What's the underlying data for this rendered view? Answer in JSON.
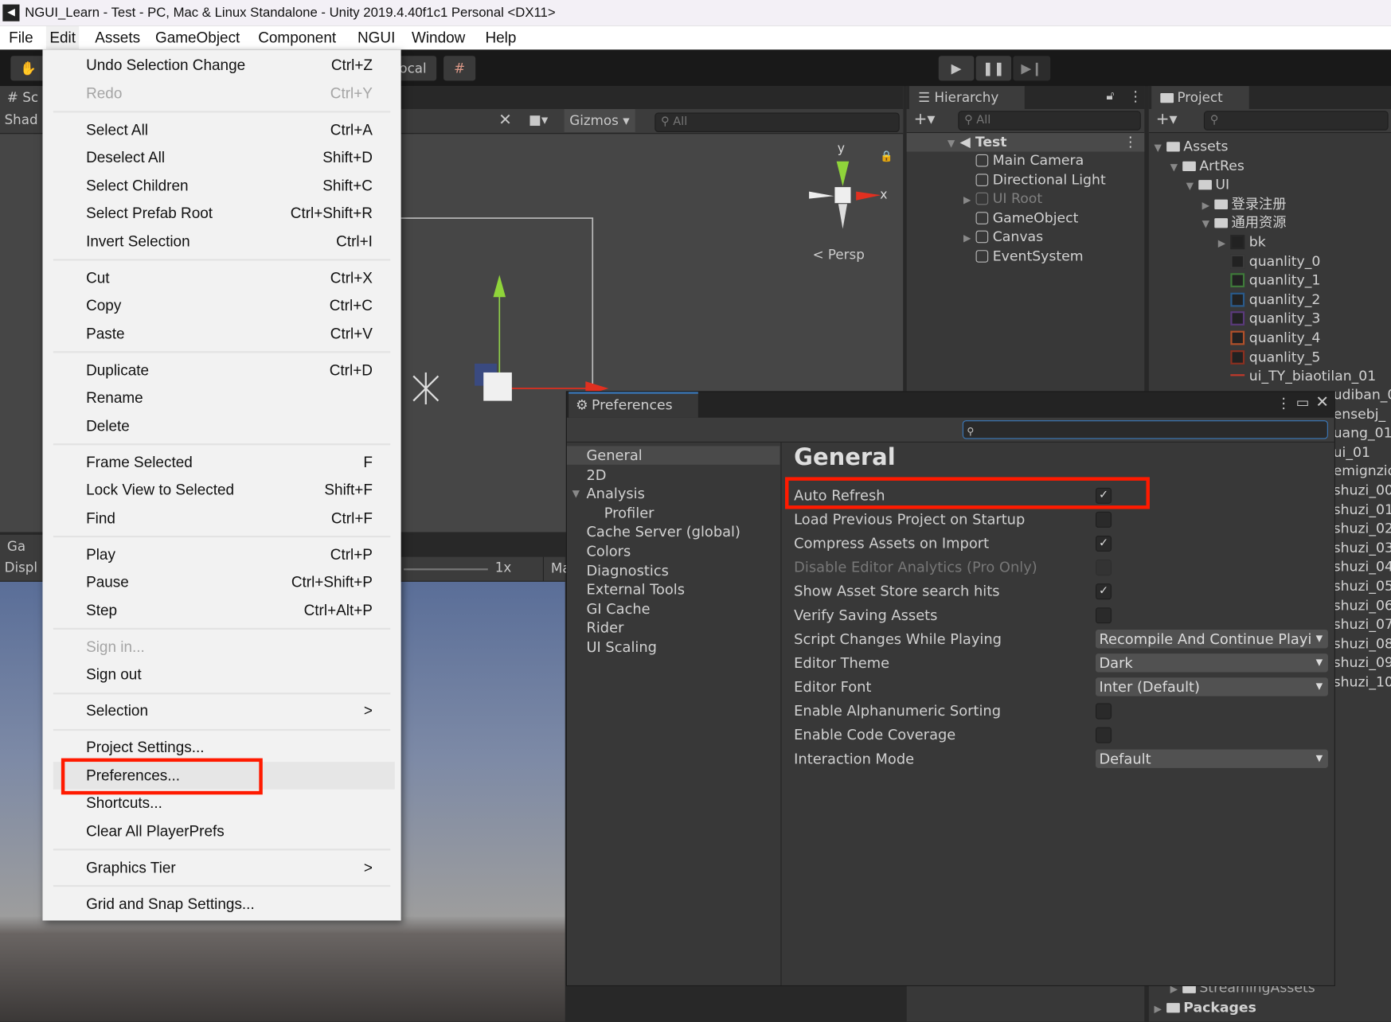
{
  "window": {
    "title": "NGUI_Learn - Test - PC, Mac & Linux Standalone - Unity 2019.4.40f1c1 Personal <DX11>",
    "logo": "unity-logo"
  },
  "menubar": [
    "File",
    "Edit",
    "Assets",
    "GameObject",
    "Component",
    "NGUI",
    "Window",
    "Help"
  ],
  "toolbar": {
    "pivot_label": "ocal",
    "play": "play-icon",
    "pause": "pause-icon",
    "step": "step-icon"
  },
  "scene": {
    "tab": "# Sc",
    "shading": "Shad",
    "gizmos": "Gizmos",
    "search_placeholder": "All",
    "persp": "< Persp",
    "axis_y": "y",
    "axis_x": "x"
  },
  "game": {
    "tab": "Ga",
    "display": "Displ",
    "scale": "1x",
    "maximize": "Ma"
  },
  "edit_menu": [
    {
      "label": "Undo Selection Change",
      "shortcut": "Ctrl+Z"
    },
    {
      "label": "Redo",
      "shortcut": "Ctrl+Y",
      "disabled": true
    },
    {
      "sep": true
    },
    {
      "label": "Select All",
      "shortcut": "Ctrl+A"
    },
    {
      "label": "Deselect All",
      "shortcut": "Shift+D"
    },
    {
      "label": "Select Children",
      "shortcut": "Shift+C"
    },
    {
      "label": "Select Prefab Root",
      "shortcut": "Ctrl+Shift+R"
    },
    {
      "label": "Invert Selection",
      "shortcut": "Ctrl+I"
    },
    {
      "sep": true
    },
    {
      "label": "Cut",
      "shortcut": "Ctrl+X"
    },
    {
      "label": "Copy",
      "shortcut": "Ctrl+C"
    },
    {
      "label": "Paste",
      "shortcut": "Ctrl+V"
    },
    {
      "sep": true
    },
    {
      "label": "Duplicate",
      "shortcut": "Ctrl+D"
    },
    {
      "label": "Rename",
      "shortcut": ""
    },
    {
      "label": "Delete",
      "shortcut": ""
    },
    {
      "sep": true
    },
    {
      "label": "Frame Selected",
      "shortcut": "F"
    },
    {
      "label": "Lock View to Selected",
      "shortcut": "Shift+F"
    },
    {
      "label": "Find",
      "shortcut": "Ctrl+F"
    },
    {
      "sep": true
    },
    {
      "label": "Play",
      "shortcut": "Ctrl+P"
    },
    {
      "label": "Pause",
      "shortcut": "Ctrl+Shift+P"
    },
    {
      "label": "Step",
      "shortcut": "Ctrl+Alt+P"
    },
    {
      "sep": true
    },
    {
      "label": "Sign in...",
      "shortcut": "",
      "disabled": true
    },
    {
      "label": "Sign out",
      "shortcut": ""
    },
    {
      "sep": true
    },
    {
      "label": "Selection",
      "shortcut": ">"
    },
    {
      "sep": true
    },
    {
      "label": "Project Settings...",
      "shortcut": ""
    },
    {
      "label": "Preferences...",
      "shortcut": "",
      "highlighted": true
    },
    {
      "label": "Shortcuts...",
      "shortcut": ""
    },
    {
      "label": "Clear All PlayerPrefs",
      "shortcut": ""
    },
    {
      "sep": true
    },
    {
      "label": "Graphics Tier",
      "shortcut": ">"
    },
    {
      "sep": true
    },
    {
      "label": "Grid and Snap Settings...",
      "shortcut": ""
    }
  ],
  "hierarchy": {
    "tab": "Hierarchy",
    "search_placeholder": "All",
    "scene": "Test",
    "items": [
      {
        "label": "Main Camera"
      },
      {
        "label": "Directional Light"
      },
      {
        "label": "UI Root",
        "expandable": true,
        "inactive": true
      },
      {
        "label": "GameObject"
      },
      {
        "label": "Canvas",
        "expandable": true
      },
      {
        "label": "EventSystem"
      }
    ]
  },
  "project": {
    "tab": "Project",
    "items": [
      {
        "label": "Assets",
        "depth": 0,
        "type": "folder-open"
      },
      {
        "label": "ArtRes",
        "depth": 1,
        "type": "folder-open"
      },
      {
        "label": "UI",
        "depth": 2,
        "type": "folder-open"
      },
      {
        "label": "登录注册",
        "depth": 3,
        "type": "folder"
      },
      {
        "label": "通用资源",
        "depth": 3,
        "type": "folder-open"
      },
      {
        "label": "bk",
        "depth": 4,
        "type": "sprite",
        "color": "#262626",
        "expandable": true
      },
      {
        "label": "quanlity_0",
        "depth": 4,
        "type": "sprite",
        "color": "#3a3a3a"
      },
      {
        "label": "quanlity_1",
        "depth": 4,
        "type": "sprite",
        "color": "#3f7a3a"
      },
      {
        "label": "quanlity_2",
        "depth": 4,
        "type": "sprite",
        "color": "#2a5a8a"
      },
      {
        "label": "quanlity_3",
        "depth": 4,
        "type": "sprite",
        "color": "#5a3a7a"
      },
      {
        "label": "quanlity_4",
        "depth": 4,
        "type": "sprite",
        "color": "#b0502a"
      },
      {
        "label": "quanlity_5",
        "depth": 4,
        "type": "sprite",
        "color": "#8a3020"
      },
      {
        "label": "ui_TY_biaotilan_01",
        "depth": 4,
        "type": "line",
        "color": "#c0392b"
      }
    ],
    "clipped_items": [
      "udiban_0",
      "ensebj_",
      "uang_01",
      "ui_01",
      "emignzid",
      "shuzi_00",
      "shuzi_01",
      "shuzi_02",
      "shuzi_03",
      "shuzi_04",
      "shuzi_05",
      "shuzi_06",
      "shuzi_07",
      "shuzi_08",
      "shuzi_09",
      "shuzi_10"
    ],
    "bottom_items": [
      {
        "label": "StreamingAssets",
        "depth": 1
      },
      {
        "label": "Packages",
        "depth": 0
      }
    ]
  },
  "preferences": {
    "title": "Preferences",
    "nav": [
      {
        "label": "General",
        "selected": true
      },
      {
        "label": "2D"
      },
      {
        "label": "Analysis",
        "expanded": true
      },
      {
        "label": "Profiler",
        "indent": true
      },
      {
        "label": "Cache Server (global)"
      },
      {
        "label": "Colors"
      },
      {
        "label": "Diagnostics"
      },
      {
        "label": "External Tools"
      },
      {
        "label": "GI Cache"
      },
      {
        "label": "Rider"
      },
      {
        "label": "UI Scaling"
      }
    ],
    "heading": "General",
    "settings": [
      {
        "label": "Auto Refresh",
        "type": "checkbox",
        "checked": true
      },
      {
        "label": "Load Previous Project on Startup",
        "type": "checkbox",
        "checked": false
      },
      {
        "label": "Compress Assets on Import",
        "type": "checkbox",
        "checked": true
      },
      {
        "label": "Disable Editor Analytics (Pro Only)",
        "type": "checkbox",
        "checked": false,
        "disabled": true
      },
      {
        "label": "Show Asset Store search hits",
        "type": "checkbox",
        "checked": true
      },
      {
        "label": "Verify Saving Assets",
        "type": "checkbox",
        "checked": false
      },
      {
        "label": "Script Changes While Playing",
        "type": "dropdown",
        "value": "Recompile And Continue Playi"
      },
      {
        "label": "Editor Theme",
        "type": "dropdown",
        "value": "Dark"
      },
      {
        "label": "Editor Font",
        "type": "dropdown",
        "value": "Inter (Default)"
      },
      {
        "label": "Enable Alphanumeric Sorting",
        "type": "checkbox",
        "checked": false
      },
      {
        "label": "Enable Code Coverage",
        "type": "checkbox",
        "checked": false
      },
      {
        "label": "Interaction Mode",
        "type": "dropdown",
        "value": "Default"
      }
    ]
  },
  "annotation_color": "#ff1a00"
}
